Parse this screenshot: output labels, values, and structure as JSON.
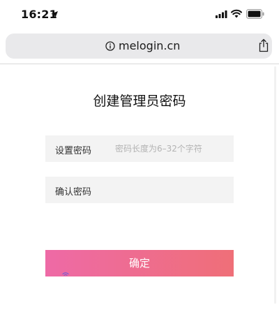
{
  "status_bar": {
    "time": "16:21",
    "icons": [
      "location-arrow-icon",
      "signal-icon",
      "wifi-icon",
      "battery-icon"
    ]
  },
  "browser": {
    "url": "melogin.cn",
    "icons": [
      "info-icon",
      "share-icon"
    ]
  },
  "form": {
    "title": "创建管理员密码",
    "set_password": {
      "label": "设置密码",
      "placeholder": "密码长度为6–32个字符",
      "value": ""
    },
    "confirm_password": {
      "label": "确认密码",
      "placeholder": "",
      "value": ""
    },
    "submit_label": "确定"
  },
  "colors": {
    "button_gradient_start": "#ee6aa6",
    "button_gradient_end": "#ef6f78",
    "field_background": "#f3f3f3",
    "address_bar_background": "#e9e9eb"
  }
}
